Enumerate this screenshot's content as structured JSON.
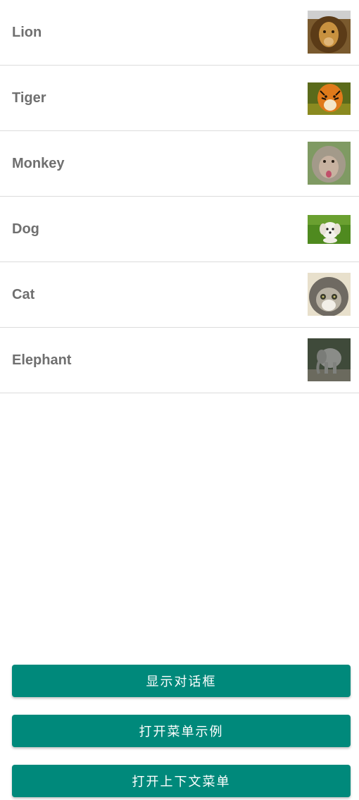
{
  "animals": [
    {
      "label": "Lion",
      "icon": "lion-photo-icon"
    },
    {
      "label": "Tiger",
      "icon": "tiger-photo-icon"
    },
    {
      "label": "Monkey",
      "icon": "monkey-photo-icon"
    },
    {
      "label": "Dog",
      "icon": "dog-photo-icon"
    },
    {
      "label": "Cat",
      "icon": "cat-photo-icon"
    },
    {
      "label": "Elephant",
      "icon": "elephant-photo-icon"
    }
  ],
  "buttons": {
    "show_dialog": "显示对话框",
    "open_menu_example": "打开菜单示例",
    "open_context_menu": "打开上下文菜单"
  },
  "colors": {
    "button_bg": "#00897b",
    "label_text": "#6f6f6f",
    "divider": "#dcdcdc"
  }
}
